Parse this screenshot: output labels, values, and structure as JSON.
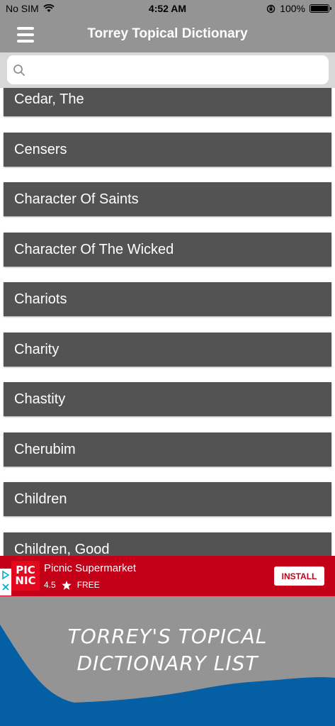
{
  "status": {
    "carrier": "No SIM",
    "time": "4:52 AM",
    "battery": "100%"
  },
  "header": {
    "title": "Torrey Topical Dictionary"
  },
  "search": {
    "placeholder": "",
    "value": ""
  },
  "items": [
    "Cedar, The",
    "Censers",
    "Character Of Saints",
    "Character Of The Wicked",
    "Chariots",
    "Charity",
    "Chastity",
    "Cherubim",
    "Children",
    "Children, Good"
  ],
  "ad": {
    "logo_line1": "PIC",
    "logo_line2": "NIC",
    "title": "Picnic Supermarket",
    "rating": "4.5",
    "price": "FREE",
    "install_label": "INSTALL"
  },
  "banner": {
    "line1": "TORREY'S TOPICAL",
    "line2": "DICTIONARY LIST"
  },
  "colors": {
    "bar": "#949494",
    "item": "#535353",
    "ad": "#c40018",
    "banner_blue": "#055fa5"
  }
}
